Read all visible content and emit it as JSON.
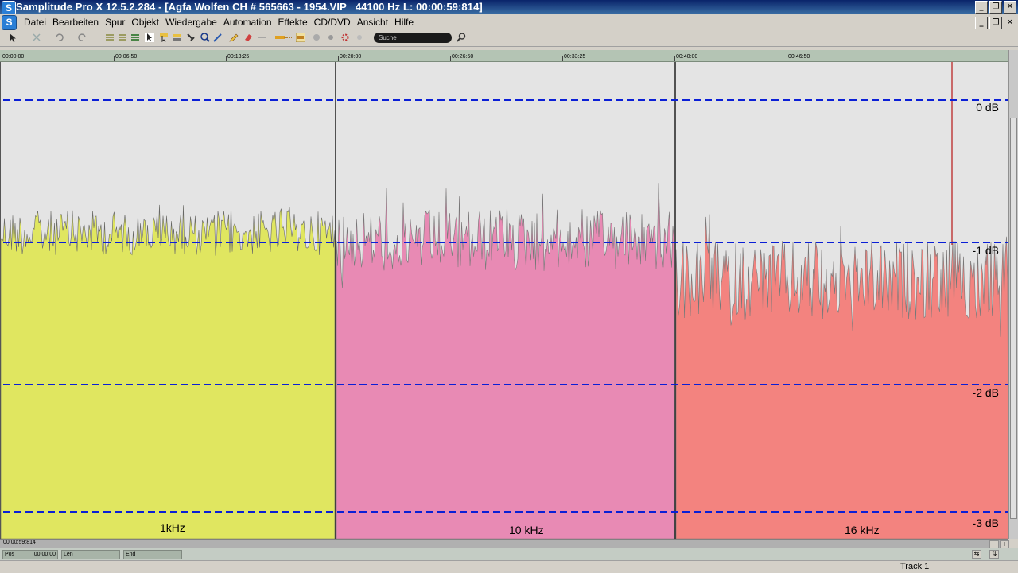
{
  "window": {
    "title": "Samplitude Pro X 12.5.2.284 - [Agfa Wolfen CH # 565663 - 1954.VIP   44100 Hz L: 00:00:59:814]",
    "app_icon": "S",
    "minimize": "_",
    "maximize": "❐",
    "close": "✕"
  },
  "menu": {
    "items": [
      "Datei",
      "Bearbeiten",
      "Spur",
      "Objekt",
      "Wiedergabe",
      "Automation",
      "Effekte",
      "CD/DVD",
      "Ansicht",
      "Hilfe"
    ]
  },
  "toolbar": {
    "search_placeholder": "Suche"
  },
  "ruler": {
    "labels": [
      "00:00:00",
      "00:06:50",
      "00:13:25",
      "00:20:00",
      "00:26:50",
      "00:33:25",
      "00:40:00",
      "00:46:50"
    ]
  },
  "track": {
    "segments": [
      {
        "label": "1kHz",
        "color": "#e0e660"
      },
      {
        "label": "10 kHz",
        "color": "#e88ab4"
      },
      {
        "label": "16 kHz",
        "color": "#f3837f"
      }
    ],
    "db_labels": [
      "0 dB",
      "-1 dB",
      "-2 dB",
      "-3 dB"
    ],
    "guide_color": "#0a1fd6"
  },
  "hscroll": {
    "text": "00:00:59:814"
  },
  "position": {
    "pos_label": "Pos",
    "pos_value": "00:00:00",
    "len_label": "Len",
    "end_label": "End"
  },
  "status": {
    "track": "Track 1"
  }
}
